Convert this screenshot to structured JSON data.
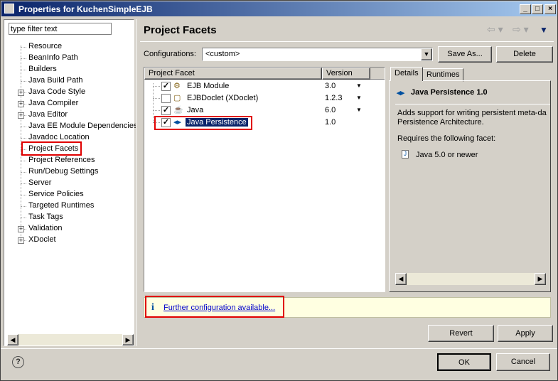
{
  "window": {
    "title": "Properties for KuchenSimpleEJB",
    "minimize": "_",
    "maximize": "□",
    "close": "×"
  },
  "filter": {
    "value": "type filter text"
  },
  "nav": {
    "items": [
      {
        "label": "Resource",
        "expandable": false
      },
      {
        "label": "BeanInfo Path",
        "expandable": false
      },
      {
        "label": "Builders",
        "expandable": false
      },
      {
        "label": "Java Build Path",
        "expandable": false
      },
      {
        "label": "Java Code Style",
        "expandable": true
      },
      {
        "label": "Java Compiler",
        "expandable": true
      },
      {
        "label": "Java Editor",
        "expandable": true
      },
      {
        "label": "Java EE Module Dependencies",
        "expandable": false
      },
      {
        "label": "Javadoc Location",
        "expandable": false
      },
      {
        "label": "Project Facets",
        "expandable": false,
        "selected": true
      },
      {
        "label": "Project References",
        "expandable": false
      },
      {
        "label": "Run/Debug Settings",
        "expandable": false
      },
      {
        "label": "Server",
        "expandable": false
      },
      {
        "label": "Service Policies",
        "expandable": false
      },
      {
        "label": "Targeted Runtimes",
        "expandable": false
      },
      {
        "label": "Task Tags",
        "expandable": false
      },
      {
        "label": "Validation",
        "expandable": true
      },
      {
        "label": "XDoclet",
        "expandable": true
      }
    ]
  },
  "page": {
    "title": "Project Facets"
  },
  "configurations": {
    "label": "Configurations:",
    "value": "<custom>",
    "save_as": "Save As...",
    "delete": "Delete"
  },
  "facets": {
    "col_facet": "Project Facet",
    "col_version": "Version",
    "rows": [
      {
        "name": "EJB Module",
        "checked": true,
        "version": "3.0",
        "dropdown": true
      },
      {
        "name": "EJBDoclet (XDoclet)",
        "checked": false,
        "version": "1.2.3",
        "dropdown": true
      },
      {
        "name": "Java",
        "checked": true,
        "version": "6.0",
        "dropdown": true
      },
      {
        "name": "Java Persistence",
        "checked": true,
        "version": "1.0",
        "dropdown": false,
        "selected": true
      }
    ]
  },
  "details": {
    "tabs": [
      "Details",
      "Runtimes"
    ],
    "heading": "Java Persistence 1.0",
    "description_1": "Adds support for writing persistent meta-da",
    "description_2": "Persistence Architecture.",
    "requires_label": "Requires the following facet:",
    "requires_item": "Java 5.0 or newer"
  },
  "info": {
    "icon": "i",
    "link": "Further configuration available..."
  },
  "buttons": {
    "revert": "Revert",
    "apply": "Apply",
    "ok": "OK",
    "cancel": "Cancel",
    "help": "?"
  },
  "colors": {
    "highlight": "#e00000",
    "selection": "#0a246a",
    "info_bg": "#ffffe1",
    "link": "#0000cc"
  }
}
